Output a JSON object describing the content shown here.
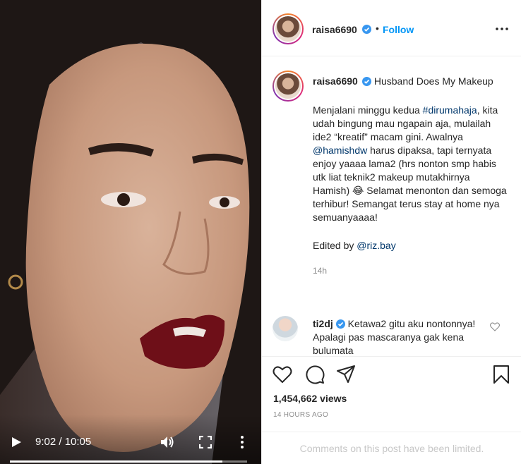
{
  "video": {
    "time_display": "9:02 / 10:05",
    "progress": 0.897
  },
  "header": {
    "username": "raisa6690",
    "separator": "•",
    "follow_label": "Follow"
  },
  "caption": {
    "username": "raisa6690",
    "title": "Husband Does My Makeup",
    "body_part1": "Menjalani minggu kedua ",
    "hashtag": "#dirumahaja",
    "body_part2": ", kita udah bingung mau ngapain aja, mulailah ide2 “kreatif” macam gini. Awalnya ",
    "mention": "@hamishdw",
    "body_part3": " harus dipaksa, tapi ternyata enjoy yaaaa lama2 (hrs nonton smp habis utk liat teknik2 makeup mutakhirnya Hamish) 😂 Selamat menonton dan semoga terhibur! Semangat terus stay at home nya semuanyaaaa!",
    "edited_prefix": "Edited by ",
    "edited_mention": "@riz.bay",
    "time": "14h"
  },
  "comment": {
    "username": "ti2dj",
    "text": "Ketawa2 gitu aku nontonnya! Apalagi pas mascaranya gak kena bulumata"
  },
  "stats": {
    "views": "1,454,662 views",
    "date": "14 HOURS AGO"
  },
  "footer": {
    "limited_text": "Comments on this post have been limited."
  },
  "colors": {
    "link": "#00376b",
    "follow": "#0095f6",
    "verified": "#3897f0"
  }
}
